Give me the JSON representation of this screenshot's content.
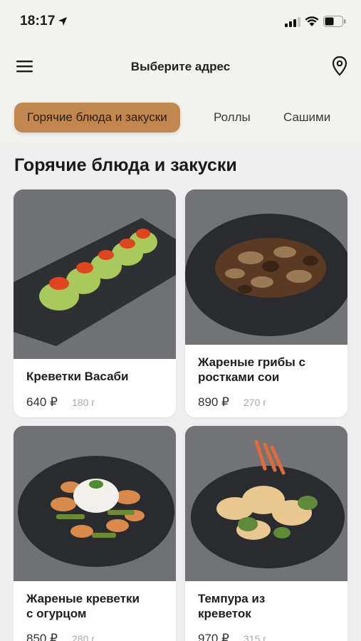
{
  "status_bar": {
    "time": "18:17"
  },
  "header": {
    "title": "Выберите адрес"
  },
  "tabs": [
    {
      "label": "Горячие блюда и закуски",
      "active": true
    },
    {
      "label": "Роллы",
      "active": false
    },
    {
      "label": "Сашими",
      "active": false
    }
  ],
  "section": {
    "title": "Горячие блюда и закуски"
  },
  "products": [
    {
      "name_line1": "Креветки Васаби",
      "name_line2": "",
      "price": "640 ₽",
      "weight": "180 г",
      "image": "shrimp-wasabi-dish"
    },
    {
      "name_line1": "Жареные грибы с",
      "name_line2": "ростками сои",
      "price": "890 ₽",
      "weight": "270 г",
      "image": "fried-mushrooms-dish"
    },
    {
      "name_line1": "Жареные креветки",
      "name_line2": "с огурцом",
      "price": "850 ₽",
      "weight": "280 г",
      "image": "fried-shrimp-cucumber-dish"
    },
    {
      "name_line1": "Темпура из",
      "name_line2": "креветок",
      "price": "970 ₽",
      "weight": "315 г",
      "image": "shrimp-tempura-dish"
    }
  ],
  "colors": {
    "accent": "#c1874f",
    "background": "#eeeeee",
    "header": "#f2f2ef",
    "card": "#ffffff"
  }
}
